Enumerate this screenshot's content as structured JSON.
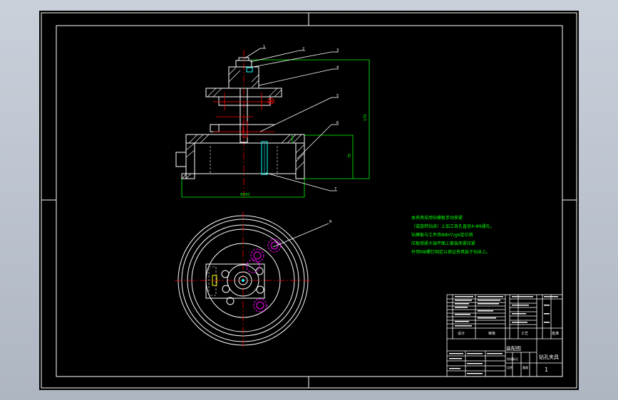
{
  "viewer": {
    "background": "#000000"
  },
  "colors": {
    "frame": "#ffffff",
    "section": "#ffffff",
    "centerline": "#ff0000",
    "dimension": "#00ff00",
    "leader": "#ffffff",
    "hidden": "#ffffff",
    "circle_pattern": "#ff00ff",
    "notes": "#00ff00",
    "hatch": "#ffffff"
  },
  "balloons": [
    "1",
    "2",
    "3",
    "4",
    "5",
    "6",
    "7",
    "8"
  ],
  "technical_notes": [
    "本夹具采用钻模板手动夹紧",
    "（或旋转钻床）上加工各孔直径4-Φ9通孔。",
    "钻模板与工件用Φ8H7/g6定位销",
    "压板锁紧大端平面上套装夹紧压紧",
    "并用M8螺钉固定以保证夹具装于钻床上。"
  ],
  "title_block": {
    "drawing_name": "钻孔夹具",
    "view_name": "装配图",
    "sheet_number": "1",
    "headers": [
      "标记",
      "处数",
      "分区",
      "更改文件号",
      "签名",
      "年月日"
    ],
    "roles": [
      "设计",
      "审核",
      "工艺",
      "批准"
    ],
    "scale_label": "比例",
    "weight_label": "重量",
    "stage_label": "阶段标记"
  },
  "dimensions": {
    "height_total": "170",
    "body_height": "75",
    "base_width": "Φ350"
  }
}
